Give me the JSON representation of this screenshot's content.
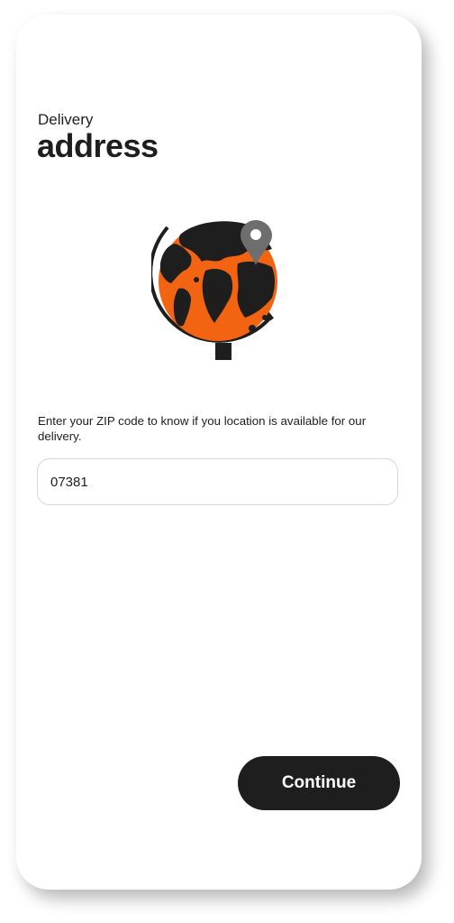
{
  "header": {
    "subtitle": "Delivery",
    "title": "address"
  },
  "illustration": {
    "icon": "globe-with-location-pin-icon",
    "colors": {
      "land": "#1e1e1e",
      "ocean": "#f26412",
      "pin": "#6e6e6e"
    }
  },
  "zip": {
    "description": "Enter your ZIP code to know if you location is available for our delivery.",
    "value": "07381",
    "placeholder": ""
  },
  "actions": {
    "continue_label": "Continue"
  },
  "theme": {
    "accent": "#1e1e1e",
    "button_text": "#ffffff"
  }
}
